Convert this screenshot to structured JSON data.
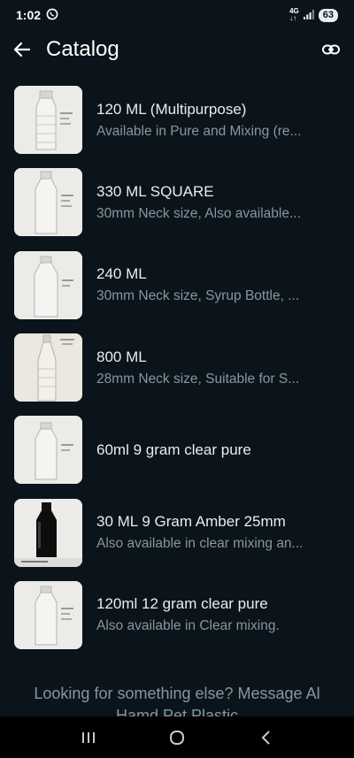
{
  "status": {
    "time": "1:02",
    "network_top": "4G",
    "network_bottom": "↓↑",
    "battery": "63"
  },
  "header": {
    "title": "Catalog"
  },
  "items": [
    {
      "name": "120 ML (Multipurpose)",
      "description": "Available in Pure and  Mixing (re..."
    },
    {
      "name": "330 ML SQUARE",
      "description": "30mm Neck size, Also available..."
    },
    {
      "name": "240 ML",
      "description": "30mm Neck size, Syrup Bottle, ..."
    },
    {
      "name": "800 ML",
      "description": "28mm Neck size, Suitable for S..."
    },
    {
      "name": "60ml 9 gram clear pure",
      "description": ""
    },
    {
      "name": "30 ML 9 Gram Amber 25mm",
      "description": "Also available in clear mixing an..."
    },
    {
      "name": "120ml 12 gram clear pure",
      "description": "Also available in Clear mixing."
    }
  ],
  "footer": {
    "text": "Looking for something else? Message Al Hamd Pet Plastic"
  },
  "icons": {
    "whatsapp": "whatsapp-icon",
    "signal": "signal-icon",
    "back": "arrow-back-icon",
    "link": "link-icon",
    "recents": "recents-icon",
    "home": "home-icon",
    "nav_back": "nav-back-icon"
  }
}
